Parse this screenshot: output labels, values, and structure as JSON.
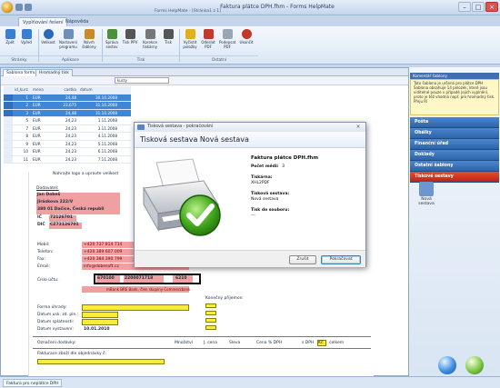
{
  "window": {
    "title": "Faktura plátce DPH.fhm - Forms HelpMate",
    "doc_title": "Forms HelpMate - [Stránka1 z 1]"
  },
  "ribbon_tabs": [
    "Vyplňování řešení",
    "Nápověda"
  ],
  "ribbon": {
    "buttons": [
      {
        "label": "Zpět",
        "color": "#3b7fd0"
      },
      {
        "label": "Vpřed",
        "color": "#3b7fd0"
      },
      {
        "label": "Velikost",
        "color": "#2f66b8"
      },
      {
        "label": "Nastavení programu",
        "color": "#6f8fb8"
      },
      {
        "label": "Návrh šablony",
        "color": "#c88a2a"
      },
      {
        "label": "Správa sestav",
        "color": "#4d8f3a"
      },
      {
        "label": "Tisk PPV",
        "color": "#555"
      },
      {
        "label": "Korekce tiskárny",
        "color": "#777"
      },
      {
        "label": "Tisk",
        "color": "#555"
      },
      {
        "label": "Vyčistit položky",
        "color": "#e0b020"
      },
      {
        "label": "Odeslat PDF",
        "color": "#c0392b"
      },
      {
        "label": "Podepsat PDF",
        "color": "#9aa5b5"
      },
      {
        "label": "Ukončit",
        "color": "#c0392b"
      }
    ],
    "groups": [
      "Stránky",
      "Aplikace",
      "Tisk",
      "Ostatní"
    ]
  },
  "doc_tabs": [
    "Šablona formuláře",
    "Hromadný tisk"
  ],
  "grid": {
    "combo_value": "kurzy",
    "headers": [
      "id_kurz",
      "mena",
      "castka",
      "datum"
    ],
    "rows": [
      {
        "id": "1",
        "mena": "EUR",
        "castka": "24,48",
        "datum": "30.10.2008",
        "selected": true
      },
      {
        "id": "2",
        "mena": "EUR",
        "castka": "23,675",
        "datum": "31.10.2008",
        "selected": true
      },
      {
        "id": "3",
        "mena": "EUR",
        "castka": "24,48",
        "datum": "31.10.2008",
        "selected": true
      },
      {
        "id": "5",
        "mena": "EUR",
        "castka": "24,23",
        "datum": "1.11.2008",
        "selected": false
      },
      {
        "id": "7",
        "mena": "EUR",
        "castka": "24,23",
        "datum": "3.11.2008",
        "selected": false
      },
      {
        "id": "8",
        "mena": "EUR",
        "castka": "24,23",
        "datum": "4.11.2008",
        "selected": false
      },
      {
        "id": "9",
        "mena": "EUR",
        "castka": "24,23",
        "datum": "5.11.2008",
        "selected": false
      },
      {
        "id": "10",
        "mena": "EUR",
        "castka": "24,23",
        "datum": "6.11.2008",
        "selected": false
      },
      {
        "id": "11",
        "mena": "EUR",
        "castka": "24,23",
        "datum": "7.11.2008",
        "selected": false
      }
    ]
  },
  "form": {
    "logo_hint": "Nahrajte logo a upravte velikost",
    "dodavatel": "Dodavatel:",
    "supplier_name": "Jan Dobeš",
    "supplier_street": "Jiráskova 222/V",
    "supplier_city": "380 01 Dačice, Česká republi",
    "ic_label": "IČ",
    "ic_value": "72126701",
    "dic_label": "DIČ",
    "dic_value": "CZ72126701",
    "mobil_label": "Mobil:",
    "mobil_value": "+420 737 814 714",
    "telefon_label": "Telefon:",
    "telefon_value": "+420 389 607 009",
    "fax_label": "Fax:",
    "fax_value": "+420 384 390 799",
    "email_label": "Email:",
    "email_value": "info@dobesoft.cz",
    "ucet_label": "Číslo účtu:",
    "ucet_1": "670100",
    "ucet_2": "2200071718",
    "ucet_3": "6210",
    "bank": "mBank BRE Bank, člen skupiny Commerzbank",
    "konecny": "Konečný příjemce:",
    "forma_uhrady": "Forma úhrady:",
    "datum_uzp": "Datum usk. zd. pln.:",
    "datum_splat": "Datum splatnosti:",
    "datum_vyst": "Datum vystavení:",
    "datum_vyst_value": "10.01.2010",
    "oznaceni": "Označení dodávky:",
    "mnozstvi": "Množství",
    "jcena": "J. cena",
    "sleva": "Sleva",
    "cena_dph": "Cena % DPH",
    "s_dph": "s DPH",
    "kc": "Kč",
    "celkem": "celkem",
    "fakturace": "Fakturace zboží dle objednávky č:"
  },
  "right_panel": {
    "header": "Komentář šablony",
    "comment": "Tato šablona je určená pro plátce DPH Šablona obsahuje 14 polozek, které jsou viditelné pouze v případě jejich vyplnění, proto je též vhodná např. pro hromadný tisk. Přeju Ri",
    "menu": [
      "Pošta",
      "Obálky",
      "Finanční úřad",
      "Doklady",
      "Ostatní šablony",
      "Tiskové sestavy"
    ],
    "active_menu": "Tiskové sestavy",
    "icon_label": "Nová sestava"
  },
  "status": {
    "text": "Faktura pro neplátce DPH"
  },
  "dialog": {
    "title": "Tisková sestava - pokračování",
    "header": "Tisková sestava Nová sestava",
    "file": "Faktura plátce DPH.fhm",
    "pocet_label": "Počet médií",
    "pocet_value": "3",
    "tiskarna_label": "Tiskárna:",
    "tiskarna_value": "XHL2PDF",
    "sestava_label": "Tisková sestava:",
    "sestava_value": "Nová sestava",
    "soubor_label": "Tisk do souboru:",
    "soubor_value": "---",
    "cancel": "Zrušit",
    "continue": "Pokračovat"
  }
}
